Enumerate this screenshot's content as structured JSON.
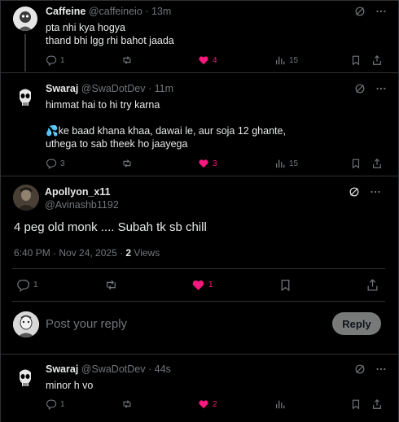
{
  "replies_top": [
    {
      "name": "Caffeine",
      "handle": "@caffeineio",
      "time": "13m",
      "lines": [
        "pta nhi kya hogya",
        "thand bhi lgg rhi bahot jaada"
      ],
      "replies": "1",
      "likes": "4",
      "views": "15"
    },
    {
      "name": "Swaraj",
      "handle": "@SwaDotDev",
      "time": "11m",
      "lines": [
        "himmat hai to hi try karna",
        "",
        "💦ke baad khana khaa, dawai le, aur soja 12 ghante,",
        "uthega to sab theek ho jaayega"
      ],
      "replies": "3",
      "likes": "3",
      "views": "15"
    }
  ],
  "focus": {
    "name": "Apollyon_x11",
    "handle": "@Avinashb1192",
    "text": "4 peg old monk .... Subah tk sb chill",
    "timestamp": "6:40 PM · Nov 24, 2025 · ",
    "views_count": "2",
    "views_label": " Views",
    "replies": "1",
    "likes": "1"
  },
  "reply_box": {
    "placeholder": "Post your reply",
    "button": "Reply"
  },
  "last_reply": {
    "name": "Swaraj",
    "handle": "@SwaDotDev",
    "time": "44s",
    "text": "minor h vo",
    "replies": "1",
    "likes": "2"
  },
  "colors": {
    "background": "#000000",
    "text": "#e7e9ea",
    "muted": "#71767b",
    "like": "#f91880",
    "divider": "#2f3336"
  }
}
